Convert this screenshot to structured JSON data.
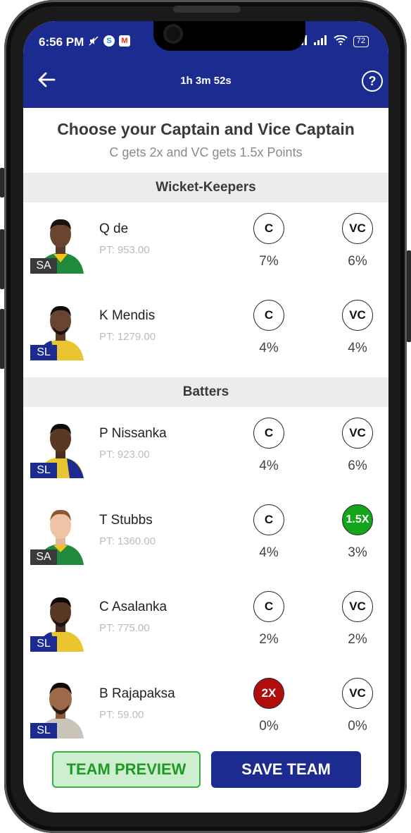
{
  "status_bar": {
    "time": "6:56 PM",
    "battery": "72",
    "left_icons": [
      "mute-icon",
      "skype-icon",
      "gmail-icon"
    ],
    "right_icons": [
      "signal-icon",
      "signal-icon",
      "wifi-icon",
      "battery-icon"
    ]
  },
  "header": {
    "timer": "1h 3m 52s",
    "back_icon": "arrow-left-icon",
    "help_label": "?"
  },
  "title": "Choose your Captain and Vice Captain",
  "subtitle": "C gets 2x and VC gets 1.5x Points",
  "sections": [
    {
      "name": "Wicket-Keepers",
      "players": [
        {
          "name": "Q de",
          "points": "PT: 953.00",
          "team": "SA",
          "c_label": "C",
          "vc_label": "VC",
          "c_pct": "7%",
          "vc_pct": "6%"
        },
        {
          "name": "K Mendis",
          "points": "PT: 1279.00",
          "team": "SL",
          "c_label": "C",
          "vc_label": "VC",
          "c_pct": "4%",
          "vc_pct": "4%"
        }
      ]
    },
    {
      "name": "Batters",
      "players": [
        {
          "name": "P Nissanka",
          "points": "PT: 923.00",
          "team": "SL",
          "c_label": "C",
          "vc_label": "VC",
          "c_pct": "4%",
          "vc_pct": "6%"
        },
        {
          "name": "T Stubbs",
          "points": "PT: 1360.00",
          "team": "SA",
          "c_label": "C",
          "vc_label": "1.5X",
          "c_pct": "4%",
          "vc_pct": "3%"
        },
        {
          "name": "C Asalanka",
          "points": "PT: 775.00",
          "team": "SL",
          "c_label": "C",
          "vc_label": "VC",
          "c_pct": "2%",
          "vc_pct": "2%"
        },
        {
          "name": "B Rajapaksa",
          "points": "PT: 59.00",
          "team": "SL",
          "c_label": "2X",
          "vc_label": "VC",
          "c_pct": "0%",
          "vc_pct": "0%"
        }
      ]
    }
  ],
  "buttons": {
    "team_preview": "TEAM PREVIEW",
    "save_team": "SAVE TEAM"
  },
  "colors": {
    "primary": "#1c2b8f",
    "captain_selected": "#b00d0d",
    "vice_captain_selected": "#13a51a",
    "preview_bg": "#cdeecf",
    "preview_text": "#1f9a25"
  }
}
